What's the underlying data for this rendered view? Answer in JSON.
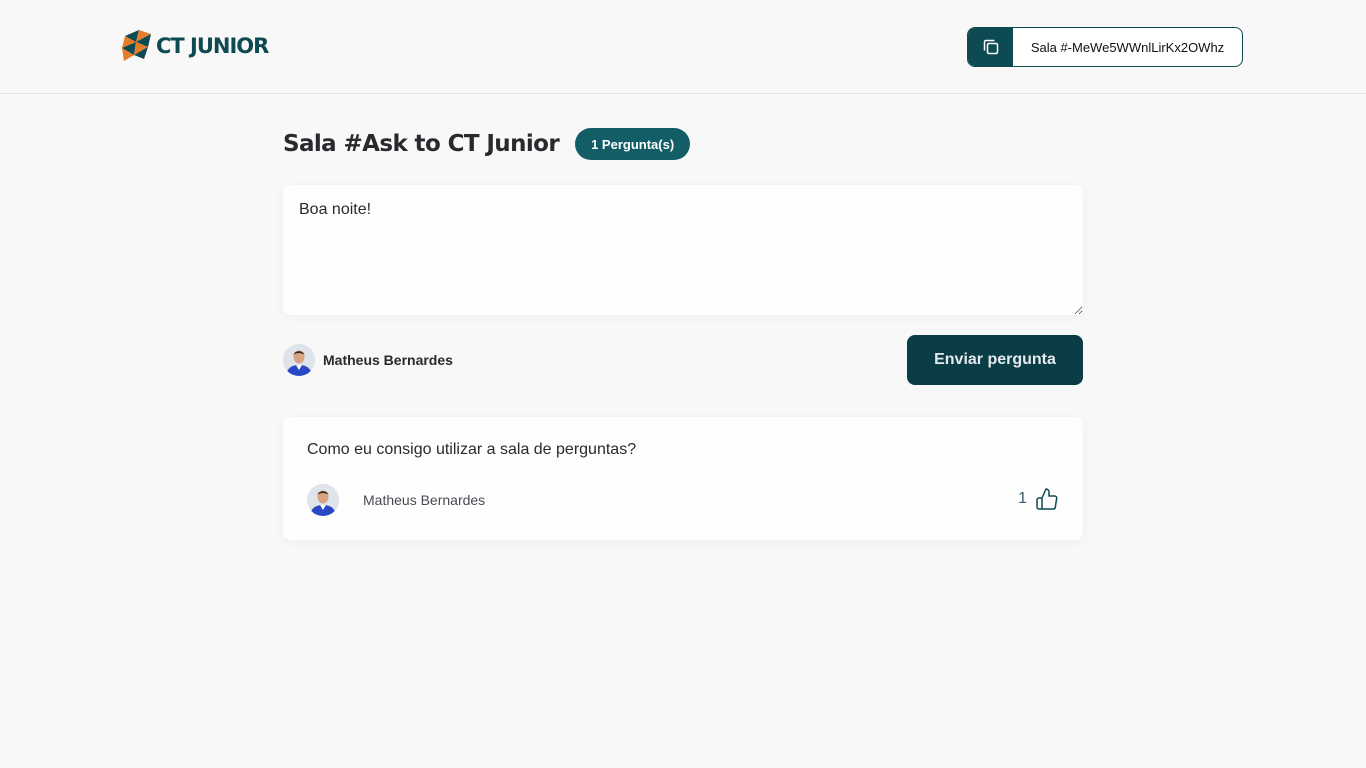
{
  "header": {
    "logo_text": "CT JUNIOR",
    "room_code": "Sala #-MeWe5WWnlLirKx2OWhz"
  },
  "room": {
    "title": "Sala #Ask to CT Junior",
    "question_count": "1 Pergunta(s)"
  },
  "form": {
    "textarea_value": "Boa noite!",
    "user_name": "Matheus Bernardes",
    "submit_label": "Enviar pergunta"
  },
  "questions": [
    {
      "content": "Como eu consigo utilizar a sala de perguntas?",
      "author": "Matheus Bernardes",
      "like_count": "1",
      "like_icon": "thumbs-up-icon"
    }
  ],
  "colors": {
    "brand": "#0e4a51",
    "badge": "#125d66",
    "button": "#0a3d45",
    "logo_accent": "#e57c2a",
    "background": "#f8f8f8"
  }
}
